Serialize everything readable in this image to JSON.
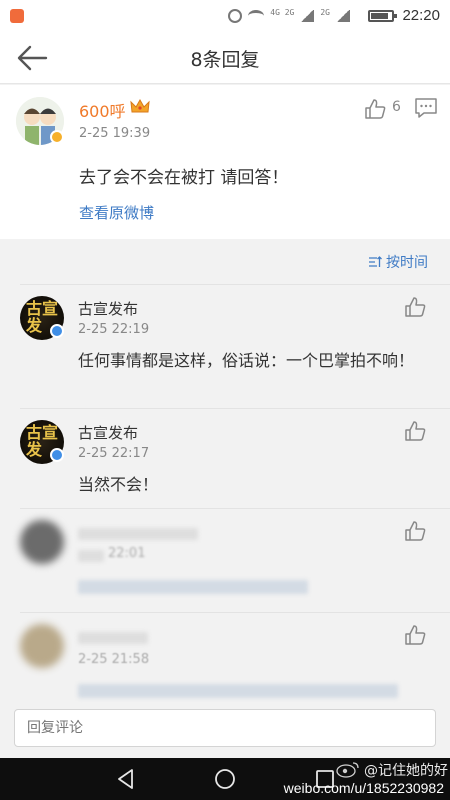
{
  "status_bar": {
    "time": "22:20",
    "network_label": "4G 2G",
    "signal_label": "2G"
  },
  "nav": {
    "title": "8条回复"
  },
  "post": {
    "author": "600呼",
    "time": "2-25 19:39",
    "like_count": "6",
    "text": "去了会不会在被打 请回答！",
    "link": "查看原微博"
  },
  "sort": {
    "label": "按时间"
  },
  "replies": [
    {
      "author": "古宣发布",
      "avatar_text": "古宣发",
      "time": "2-25 22:19",
      "text": "任何事情都是这样，俗话说：一个巴掌拍不响！"
    },
    {
      "author": "古宣发布",
      "avatar_text": "古宣发",
      "time": "2-25 22:17",
      "text": "当然不会！"
    },
    {
      "author": "",
      "time": "22:01",
      "text": "",
      "blurred": true
    },
    {
      "author": "",
      "time": "2-25 21:58",
      "text": "",
      "blurred": true
    }
  ],
  "input": {
    "placeholder": "回复评论"
  },
  "watermark": {
    "url": "weibo.com/u/1852230982",
    "account": "@记住她的好"
  },
  "colors": {
    "accent_blue": "#3f7bc5",
    "name_orange": "#f07a2a",
    "verified_blue": "#3f8ee6",
    "verified_gold": "#f6b02b"
  },
  "icons": [
    "back-arrow-icon",
    "thumb-up-icon",
    "comment-icon",
    "sort-icon",
    "alarm-icon",
    "wifi-icon",
    "battery-icon",
    "crown-icon",
    "verified-badge-icon"
  ]
}
